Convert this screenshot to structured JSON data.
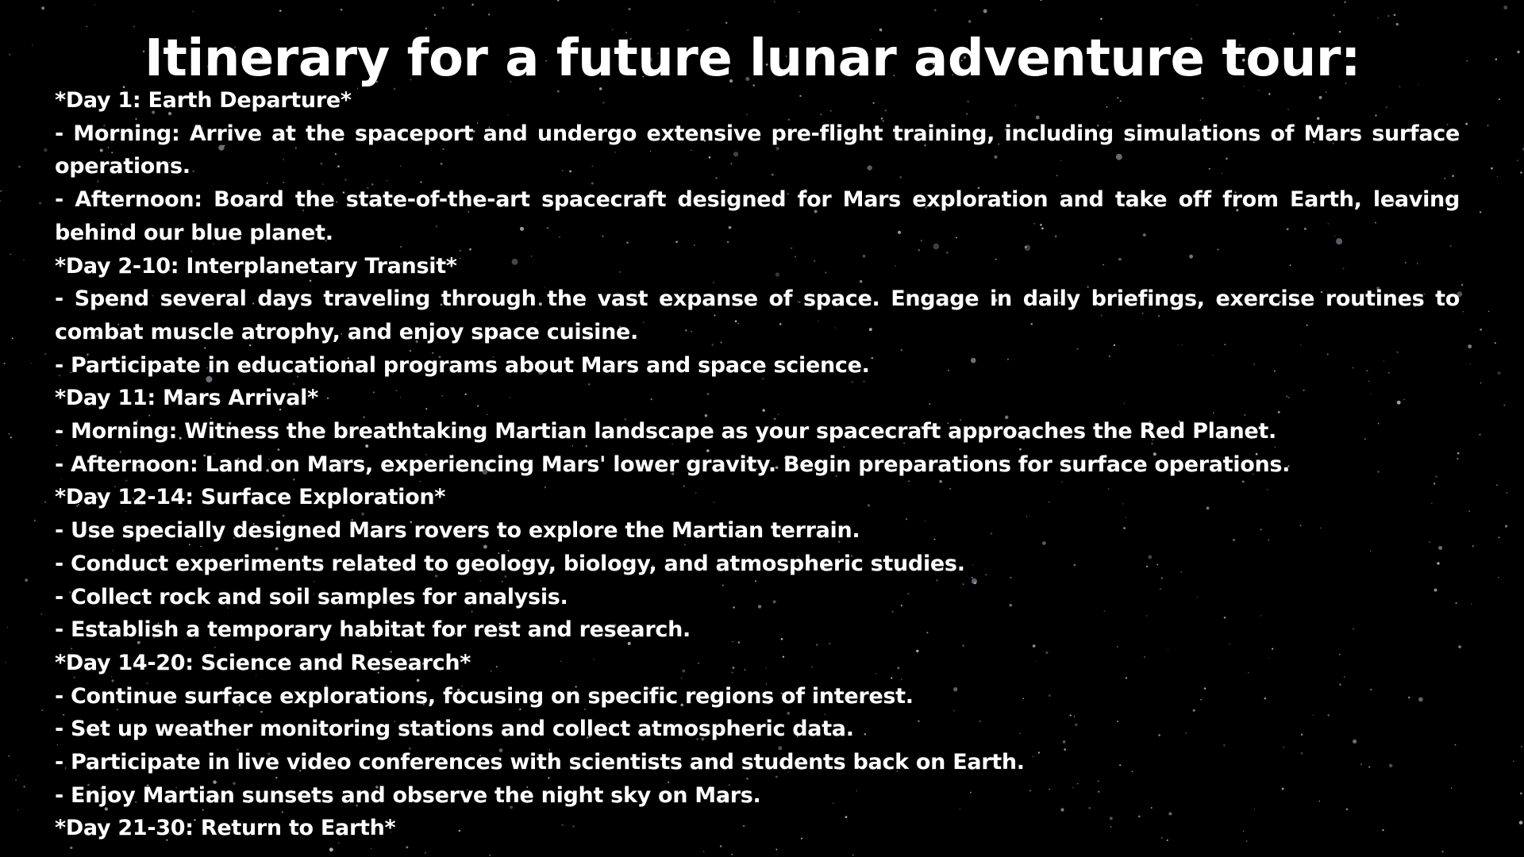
{
  "title": "Itinerary for a future lunar adventure tour:",
  "lines": [
    "*Day 1: Earth Departure*",
    "- Morning: Arrive at the spaceport and undergo extensive pre-flight training, including simulations of Mars surface operations.",
    "- Afternoon: Board the state-of-the-art spacecraft designed for Mars exploration and take off from Earth, leaving behind our blue planet.",
    "*Day 2-10: Interplanetary Transit*",
    "- Spend several days traveling through the vast expanse of space. Engage in daily briefings, exercise routines to combat muscle atrophy, and enjoy space cuisine.",
    "- Participate in educational programs about Mars and space science.",
    "*Day 11: Mars Arrival*",
    "- Morning: Witness the breathtaking Martian landscape as your spacecraft approaches the Red Planet.",
    "- Afternoon: Land on Mars, experiencing Mars' lower gravity. Begin preparations for surface operations.",
    "*Day 12-14: Surface Exploration*",
    "- Use specially designed Mars rovers to explore the Martian terrain.",
    "- Conduct experiments related to geology, biology, and atmospheric studies.",
    "- Collect rock and soil samples for analysis.",
    "- Establish a temporary habitat for rest and research.",
    "*Day 14-20: Science and Research*",
    "- Continue surface explorations, focusing on specific regions of interest.",
    "- Set up weather monitoring stations and collect atmospheric data.",
    "- Participate in live video conferences with scientists and students back on Earth.",
    "- Enjoy Martian sunsets and observe the night sky on Mars.",
    "*Day 21-30: Return to Earth*"
  ],
  "colors": {
    "background": "#000000",
    "text": "#ffffff"
  }
}
